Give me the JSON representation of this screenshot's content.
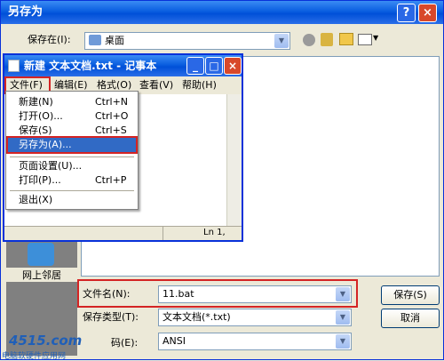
{
  "dialog": {
    "title": "另存为",
    "help_label": "?",
    "close_label": "×",
    "save_in_label": "保存在(I):",
    "save_in_value": "桌面",
    "places": {
      "network": "网上邻居"
    },
    "filename_label": "文件名(N):",
    "filename_value": "11.bat",
    "filetype_label": "保存类型(T):",
    "filetype_value": "文本文档(*.txt)",
    "encoding_label": "码(E):",
    "encoding_value": "ANSI",
    "save_button": "保存(S)",
    "cancel_button": "取消"
  },
  "notepad": {
    "title": "新建 文本文档.txt - 记事本",
    "menus": [
      "文件(F)",
      "编辑(E)",
      "格式(O)",
      "查看(V)",
      "帮助(H)"
    ],
    "status": "Ln 1,",
    "file_menu": [
      {
        "label": "新建(N)",
        "shortcut": "Ctrl+N"
      },
      {
        "label": "打开(O)...",
        "shortcut": "Ctrl+O"
      },
      {
        "label": "保存(S)",
        "shortcut": "Ctrl+S"
      },
      {
        "label": "另存为(A)...",
        "shortcut": ""
      },
      {
        "label": "页面设置(U)...",
        "shortcut": ""
      },
      {
        "label": "打印(P)...",
        "shortcut": "Ctrl+P"
      },
      {
        "label": "退出(X)",
        "shortcut": ""
      }
    ]
  },
  "watermark": {
    "logo": "4515.com",
    "caption": "电脑软硬件应用网"
  },
  "colors": {
    "highlight": "#316ac5",
    "annotation_red": "#d42424",
    "title_blue": "#0a5ee0"
  }
}
